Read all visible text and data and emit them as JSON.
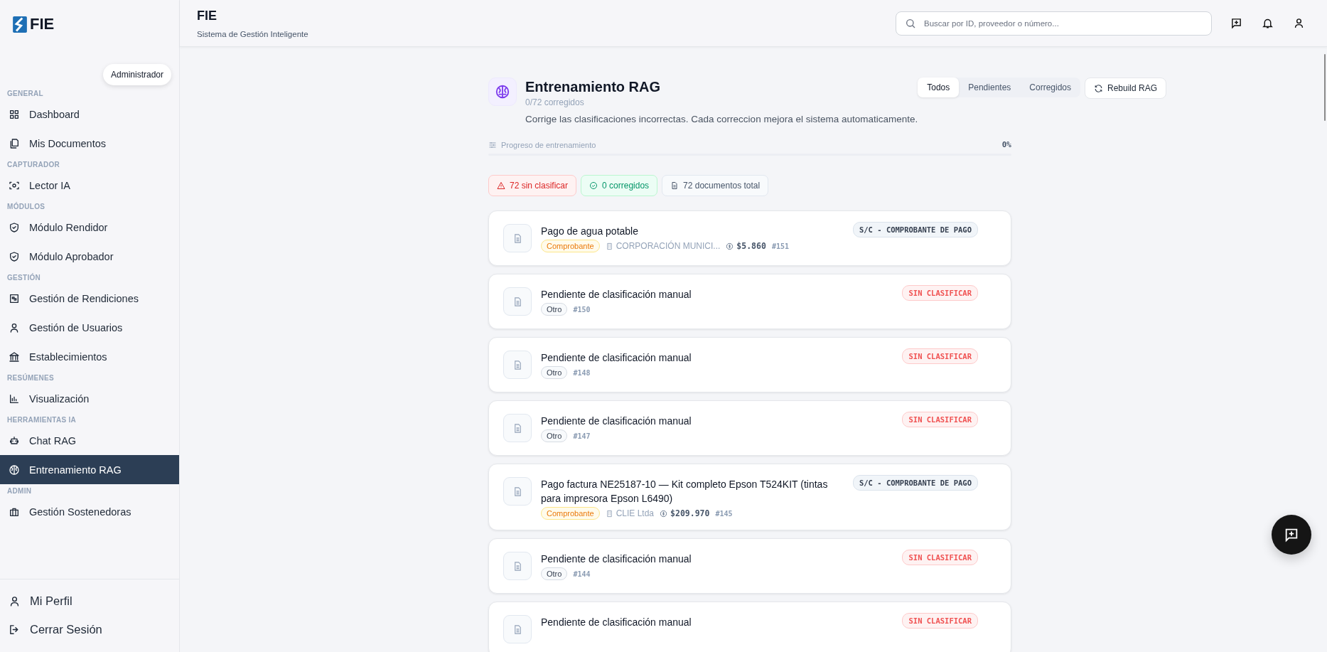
{
  "brand": {
    "name": "FIE"
  },
  "role_chip": "Administrador",
  "sidebar": {
    "sections": [
      {
        "heading": "GENERAL",
        "items": [
          {
            "label": "Dashboard",
            "selected": false
          },
          {
            "label": "Mis Documentos",
            "selected": false
          }
        ]
      },
      {
        "heading": "CAPTURADOR",
        "items": [
          {
            "label": "Lector IA",
            "selected": false
          }
        ]
      },
      {
        "heading": "MÓDULOS",
        "items": [
          {
            "label": "Módulo Rendidor",
            "selected": false
          },
          {
            "label": "Módulo Aprobador",
            "selected": false
          }
        ]
      },
      {
        "heading": "GESTIÓN",
        "items": [
          {
            "label": "Gestión de Rendiciones",
            "selected": false
          },
          {
            "label": "Gestión de Usuarios",
            "selected": false
          },
          {
            "label": "Establecimientos",
            "selected": false
          }
        ]
      },
      {
        "heading": "RESÚMENES",
        "items": [
          {
            "label": "Visualización",
            "selected": false
          }
        ]
      },
      {
        "heading": "HERRAMIENTAS IA",
        "items": [
          {
            "label": "Chat RAG",
            "selected": false
          },
          {
            "label": "Entrenamiento RAG",
            "selected": true
          }
        ]
      },
      {
        "heading": "ADMIN",
        "items": [
          {
            "label": "Gestión Sostenedoras",
            "selected": false
          }
        ]
      }
    ],
    "footer": [
      {
        "label": "Mi Perfil"
      },
      {
        "label": "Cerrar Sesión"
      }
    ]
  },
  "header": {
    "title": "FIE",
    "subtitle": "Sistema de Gestión Inteligente",
    "search": {
      "placeholder": "Buscar por ID, proveedor o número..."
    }
  },
  "training": {
    "title": "Entrenamiento RAG",
    "count": "0/72 corregidos",
    "description": "Corrige las clasificaciones incorrectas. Cada correccion mejora el sistema automaticamente.",
    "filters": [
      {
        "label": "Todos",
        "selected": true
      },
      {
        "label": "Pendientes",
        "selected": false
      },
      {
        "label": "Corregidos",
        "selected": false
      }
    ],
    "rebuild_button": "Rebuild RAG",
    "progress": {
      "label": "Progreso de entrenamiento",
      "level": 0,
      "reading": "0%"
    },
    "stats": [
      {
        "kind": "danger",
        "text": "72 sin clasificar"
      },
      {
        "kind": "success",
        "text": "0 corregidos"
      },
      {
        "kind": "neutral",
        "text": "72 documentos total"
      }
    ],
    "documents": [
      {
        "title": "Pago de agua potable",
        "tag": {
          "kind": "warning",
          "label": "Comprobante"
        },
        "vendor": "CORPORACIÓN MUNICI...",
        "amount": "$5.860",
        "number": "#151",
        "badge": {
          "kind": "type",
          "label": "S/C - COMPROBANTE DE PAGO"
        }
      },
      {
        "title": "Pendiente de clasificación manual",
        "tag": {
          "kind": "neutral",
          "label": "Otro"
        },
        "number": "#150",
        "badge": {
          "kind": "danger",
          "label": "SIN CLASIFICAR"
        }
      },
      {
        "title": "Pendiente de clasificación manual",
        "tag": {
          "kind": "neutral",
          "label": "Otro"
        },
        "number": "#148",
        "badge": {
          "kind": "danger",
          "label": "SIN CLASIFICAR"
        }
      },
      {
        "title": "Pendiente de clasificación manual",
        "tag": {
          "kind": "neutral",
          "label": "Otro"
        },
        "number": "#147",
        "badge": {
          "kind": "danger",
          "label": "SIN CLASIFICAR"
        }
      },
      {
        "title": "Pago factura NE25187-10 — Kit completo Epson T524KIT (tintas para impresora Epson L6490)",
        "tag": {
          "kind": "warning",
          "label": "Comprobante"
        },
        "vendor": "CLIE Ltda",
        "amount": "$209.970",
        "number": "#145",
        "badge": {
          "kind": "type",
          "label": "S/C - COMPROBANTE DE PAGO"
        }
      },
      {
        "title": "Pendiente de clasificación manual",
        "tag": {
          "kind": "neutral",
          "label": "Otro"
        },
        "number": "#144",
        "badge": {
          "kind": "danger",
          "label": "SIN CLASIFICAR"
        }
      },
      {
        "title": "Pendiente de clasificación manual",
        "badge": {
          "kind": "danger",
          "label": "SIN CLASIFICAR"
        }
      }
    ]
  }
}
